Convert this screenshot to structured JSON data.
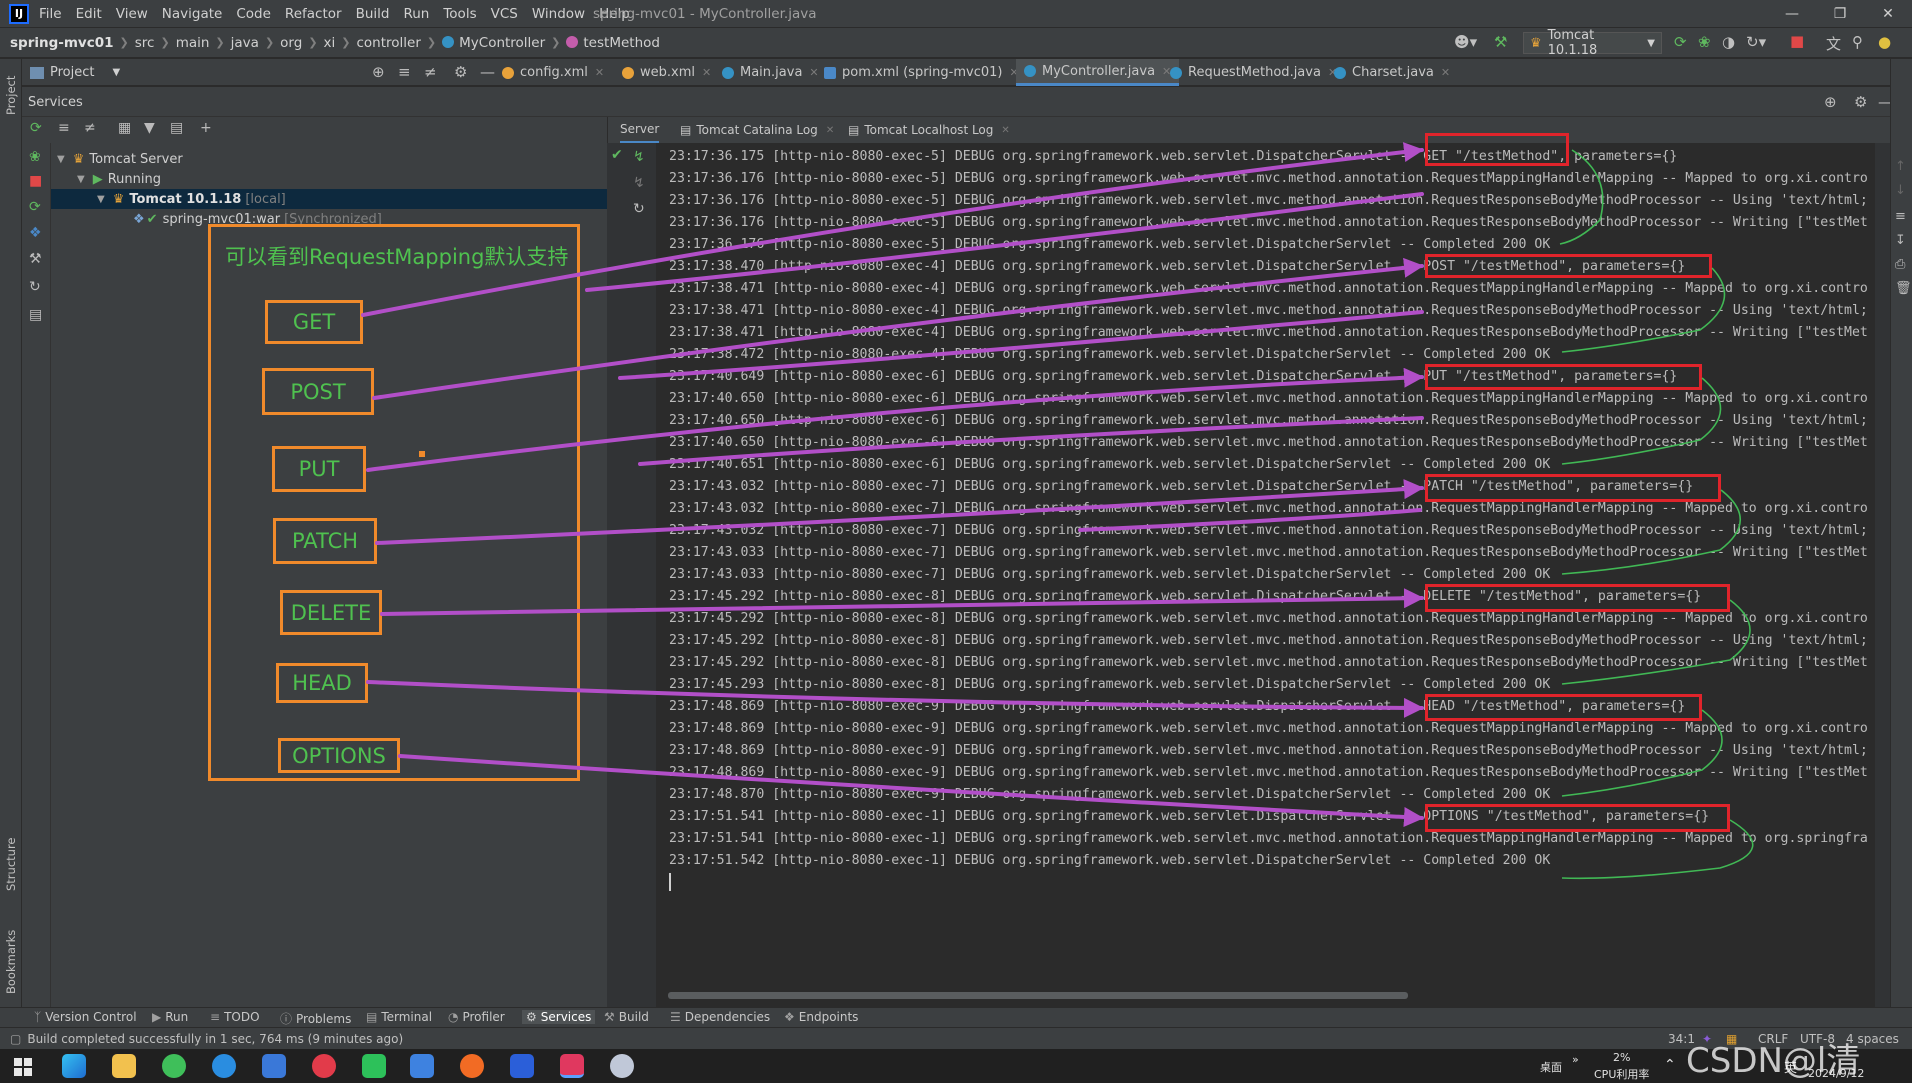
{
  "menu": {
    "logo": "IJ",
    "items": [
      "File",
      "Edit",
      "View",
      "Navigate",
      "Code",
      "Refactor",
      "Build",
      "Run",
      "Tools",
      "VCS",
      "Window",
      "Help"
    ],
    "window_title": "spring-mvc01 - MyController.java"
  },
  "breadcrumb": {
    "project": "spring-mvc01",
    "parts": [
      "src",
      "main",
      "java",
      "org",
      "xi",
      "controller"
    ],
    "class_name": "MyController",
    "method_name": "testMethod"
  },
  "run_config": {
    "label": "Tomcat 10.1.18"
  },
  "left_strip": {
    "project": "Project",
    "structure": "Structure",
    "bookmarks": "Bookmarks"
  },
  "tabs": {
    "project_label": "Project",
    "files": [
      {
        "label": "config.xml",
        "color": "#e8a23a"
      },
      {
        "label": "web.xml",
        "color": "#e8a23a"
      },
      {
        "label": "Main.java",
        "color": "#3592c4"
      },
      {
        "label": "pom.xml (spring-mvc01)",
        "color": "#4a88c7"
      },
      {
        "label": "MyController.java",
        "color": "#3592c4"
      },
      {
        "label": "RequestMethod.java",
        "color": "#3592c4"
      },
      {
        "label": "Charset.java",
        "color": "#3592c4"
      }
    ],
    "active_index": 4
  },
  "services": {
    "title": "Services",
    "tree": {
      "server": "Tomcat Server",
      "running": "Running",
      "tomcat": "Tomcat 10.1.18",
      "tomcat_tag": "[local]",
      "artifact": "spring-mvc01:war",
      "artifact_tag": "[Synchronized]"
    }
  },
  "annotation": {
    "title": "可以看到RequestMapping默认支持",
    "methods": [
      "GET",
      "POST",
      "PUT",
      "PATCH",
      "DELETE",
      "HEAD",
      "OPTIONS"
    ]
  },
  "log_tabs": [
    "Server",
    "Tomcat Catalina Log",
    "Tomcat Localhost Log"
  ],
  "log_lines": [
    "23:17:36.175 [http-nio-8080-exec-5] DEBUG org.springframework.web.servlet.DispatcherServlet -- GET \"/testMethod\", parameters={}",
    "23:17:36.176 [http-nio-8080-exec-5] DEBUG org.springframework.web.servlet.mvc.method.annotation.RequestMappingHandlerMapping -- Mapped to org.xi.contro",
    "23:17:36.176 [http-nio-8080-exec-5] DEBUG org.springframework.web.servlet.mvc.method.annotation.RequestResponseBodyMethodProcessor -- Using 'text/html;",
    "23:17:36.176 [http-nio-8080-exec-5] DEBUG org.springframework.web.servlet.mvc.method.annotation.RequestResponseBodyMethodProcessor -- Writing [\"testMet",
    "23:17:36.176 [http-nio-8080-exec-5] DEBUG org.springframework.web.servlet.DispatcherServlet -- Completed 200 OK",
    "23:17:38.470 [http-nio-8080-exec-4] DEBUG org.springframework.web.servlet.DispatcherServlet -- POST \"/testMethod\", parameters={}",
    "23:17:38.471 [http-nio-8080-exec-4] DEBUG org.springframework.web.servlet.mvc.method.annotation.RequestMappingHandlerMapping -- Mapped to org.xi.contro",
    "23:17:38.471 [http-nio-8080-exec-4] DEBUG org.springframework.web.servlet.mvc.method.annotation.RequestResponseBodyMethodProcessor -- Using 'text/html;",
    "23:17:38.471 [http-nio-8080-exec-4] DEBUG org.springframework.web.servlet.mvc.method.annotation.RequestResponseBodyMethodProcessor -- Writing [\"testMet",
    "23:17:38.472 [http-nio-8080-exec-4] DEBUG org.springframework.web.servlet.DispatcherServlet -- Completed 200 OK",
    "23:17:40.649 [http-nio-8080-exec-6] DEBUG org.springframework.web.servlet.DispatcherServlet -- PUT \"/testMethod\", parameters={}",
    "23:17:40.650 [http-nio-8080-exec-6] DEBUG org.springframework.web.servlet.mvc.method.annotation.RequestMappingHandlerMapping -- Mapped to org.xi.contro",
    "23:17:40.650 [http-nio-8080-exec-6] DEBUG org.springframework.web.servlet.mvc.method.annotation.RequestResponseBodyMethodProcessor -- Using 'text/html;",
    "23:17:40.650 [http-nio-8080-exec-6] DEBUG org.springframework.web.servlet.mvc.method.annotation.RequestResponseBodyMethodProcessor -- Writing [\"testMet",
    "23:17:40.651 [http-nio-8080-exec-6] DEBUG org.springframework.web.servlet.DispatcherServlet -- Completed 200 OK",
    "23:17:43.032 [http-nio-8080-exec-7] DEBUG org.springframework.web.servlet.DispatcherServlet -- PATCH \"/testMethod\", parameters={}",
    "23:17:43.032 [http-nio-8080-exec-7] DEBUG org.springframework.web.servlet.mvc.method.annotation.RequestMappingHandlerMapping -- Mapped to org.xi.contro",
    "23:17:43.032 [http-nio-8080-exec-7] DEBUG org.springframework.web.servlet.mvc.method.annotation.RequestResponseBodyMethodProcessor -- Using 'text/html;",
    "23:17:43.033 [http-nio-8080-exec-7] DEBUG org.springframework.web.servlet.mvc.method.annotation.RequestResponseBodyMethodProcessor -- Writing [\"testMet",
    "23:17:43.033 [http-nio-8080-exec-7] DEBUG org.springframework.web.servlet.DispatcherServlet -- Completed 200 OK",
    "23:17:45.292 [http-nio-8080-exec-8] DEBUG org.springframework.web.servlet.DispatcherServlet -- DELETE \"/testMethod\", parameters={}",
    "23:17:45.292 [http-nio-8080-exec-8] DEBUG org.springframework.web.servlet.mvc.method.annotation.RequestMappingHandlerMapping -- Mapped to org.xi.contro",
    "23:17:45.292 [http-nio-8080-exec-8] DEBUG org.springframework.web.servlet.mvc.method.annotation.RequestResponseBodyMethodProcessor -- Using 'text/html;",
    "23:17:45.292 [http-nio-8080-exec-8] DEBUG org.springframework.web.servlet.mvc.method.annotation.RequestResponseBodyMethodProcessor -- Writing [\"testMet",
    "23:17:45.293 [http-nio-8080-exec-8] DEBUG org.springframework.web.servlet.DispatcherServlet -- Completed 200 OK",
    "23:17:48.869 [http-nio-8080-exec-9] DEBUG org.springframework.web.servlet.DispatcherServlet -- HEAD \"/testMethod\", parameters={}",
    "23:17:48.869 [http-nio-8080-exec-9] DEBUG org.springframework.web.servlet.mvc.method.annotation.RequestMappingHandlerMapping -- Mapped to org.xi.contro",
    "23:17:48.869 [http-nio-8080-exec-9] DEBUG org.springframework.web.servlet.mvc.method.annotation.RequestResponseBodyMethodProcessor -- Using 'text/html;",
    "23:17:48.869 [http-nio-8080-exec-9] DEBUG org.springframework.web.servlet.mvc.method.annotation.RequestResponseBodyMethodProcessor -- Writing [\"testMet",
    "23:17:48.870 [http-nio-8080-exec-9] DEBUG org.springframework.web.servlet.DispatcherServlet -- Completed 200 OK",
    "23:17:51.541 [http-nio-8080-exec-1] DEBUG org.springframework.web.servlet.DispatcherServlet -- OPTIONS \"/testMethod\", parameters={}",
    "23:17:51.541 [http-nio-8080-exec-1] DEBUG org.springframework.web.servlet.mvc.method.annotation.RequestMappingHandlerMapping -- Mapped to org.springfra",
    "23:17:51.542 [http-nio-8080-exec-1] DEBUG org.springframework.web.servlet.DispatcherServlet -- Completed 200 OK"
  ],
  "bottom_tools": [
    {
      "label": "Version Control",
      "icon": "branch-icon"
    },
    {
      "label": "Run",
      "icon": "play-icon"
    },
    {
      "label": "TODO",
      "icon": "list-icon"
    },
    {
      "label": "Problems",
      "icon": "info-icon"
    },
    {
      "label": "Terminal",
      "icon": "terminal-icon"
    },
    {
      "label": "Profiler",
      "icon": "profiler-icon"
    },
    {
      "label": "Services",
      "icon": "services-icon"
    },
    {
      "label": "Build",
      "icon": "hammer-icon"
    },
    {
      "label": "Dependencies",
      "icon": "layers-icon"
    },
    {
      "label": "Endpoints",
      "icon": "endpoints-icon"
    }
  ],
  "active_bottom_tool": "Services",
  "status": {
    "message": "Build completed successfully in 1 sec, 764 ms (9 minutes ago)",
    "position": "34:1",
    "line_sep": "CRLF",
    "encoding": "UTF-8",
    "indent": "4 spaces"
  },
  "taskbar": {
    "desktop": "桌面",
    "cpu_percent": "2%",
    "cpu_label": "CPU利用率",
    "ime": "英",
    "date": "2024/9/12"
  },
  "watermark": "CSDN@l清",
  "colors": {
    "annotation_orange": "#f08a2b",
    "annotation_green": "#4fc14f",
    "highlight_red": "#e0242b",
    "arrow_purple": "#b24fc8"
  }
}
